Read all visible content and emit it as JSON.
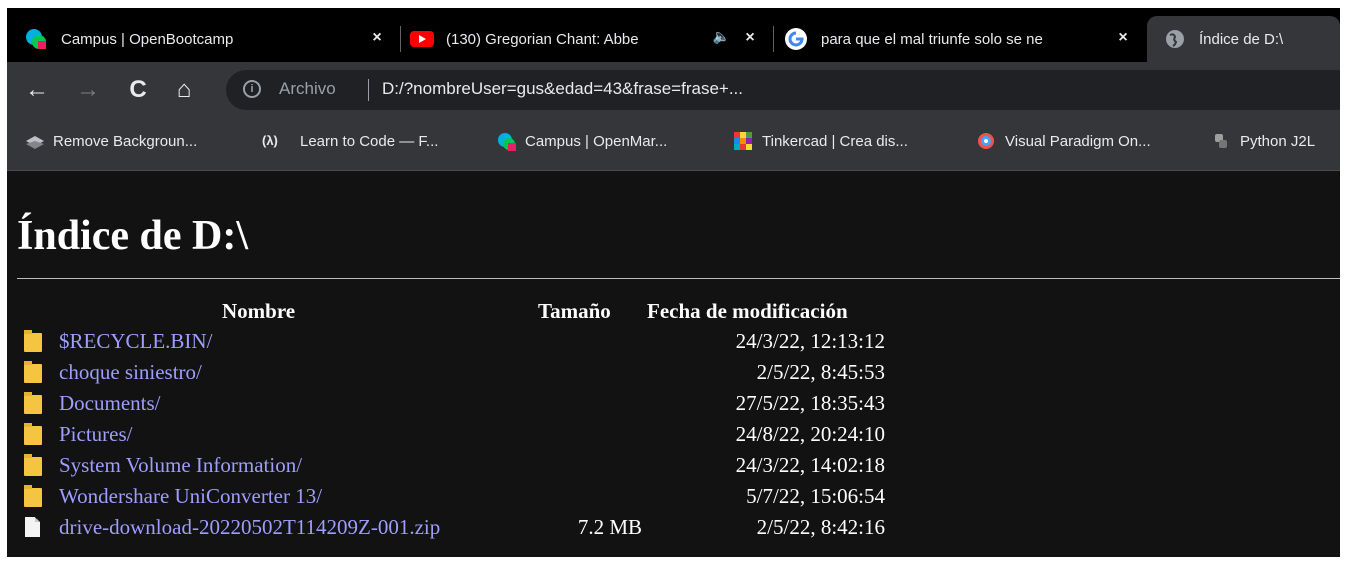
{
  "tabs": [
    {
      "title": "Campus | OpenBootcamp",
      "favicon": "openbootcamp-icon",
      "close": "×"
    },
    {
      "title": "(130) Gregorian Chant: Abbe",
      "favicon": "youtube-icon",
      "audio": "🔈",
      "close": "×"
    },
    {
      "title": "para que el mal triunfe solo se ne",
      "favicon": "google-icon",
      "close": "×"
    },
    {
      "title": "Índice de D:\\",
      "favicon": "globe-icon"
    }
  ],
  "toolbar": {
    "back": "←",
    "forward": "→",
    "reload": "C",
    "home": "⌂",
    "info": "i",
    "scheme_label": "Archivo",
    "url": "D:/?nombreUser=gus&edad=43&frase=frase+..."
  },
  "bookmarks": [
    {
      "label": "Remove Backgroun...",
      "icon": "layers-icon"
    },
    {
      "label": "Learn to Code — F...",
      "icon": "freecodecamp-icon",
      "glyph": "(λ)"
    },
    {
      "label": "Campus | OpenMar...",
      "icon": "openbootcamp-icon"
    },
    {
      "label": "Tinkercad | Crea dis...",
      "icon": "tinkercad-icon"
    },
    {
      "label": "Visual Paradigm On...",
      "icon": "visual-paradigm-icon"
    },
    {
      "label": "Python J2L",
      "icon": "python-icon"
    }
  ],
  "page": {
    "title": "Índice de D:\\",
    "headers": {
      "name": "Nombre",
      "size": "Tamaño",
      "date": "Fecha de modificación"
    },
    "rows": [
      {
        "name": "$RECYCLE.BIN/",
        "size": "",
        "date": "24/3/22, 12:13:12",
        "type": "folder"
      },
      {
        "name": "choque siniestro/",
        "size": "",
        "date": "2/5/22, 8:45:53",
        "type": "folder"
      },
      {
        "name": "Documents/",
        "size": "",
        "date": "27/5/22, 18:35:43",
        "type": "folder"
      },
      {
        "name": "Pictures/",
        "size": "",
        "date": "24/8/22, 20:24:10",
        "type": "folder"
      },
      {
        "name": "System Volume Information/",
        "size": "",
        "date": "24/3/22, 14:02:18",
        "type": "folder"
      },
      {
        "name": "Wondershare UniConverter 13/",
        "size": "",
        "date": "5/7/22, 15:06:54",
        "type": "folder"
      },
      {
        "name": "drive-download-20220502T114209Z-001.zip",
        "size": "7.2 MB",
        "date": "2/5/22, 8:42:16",
        "type": "file"
      }
    ]
  },
  "colors": {
    "link": "#9e9eff",
    "background": "#121212",
    "folder": "#f5c542"
  }
}
